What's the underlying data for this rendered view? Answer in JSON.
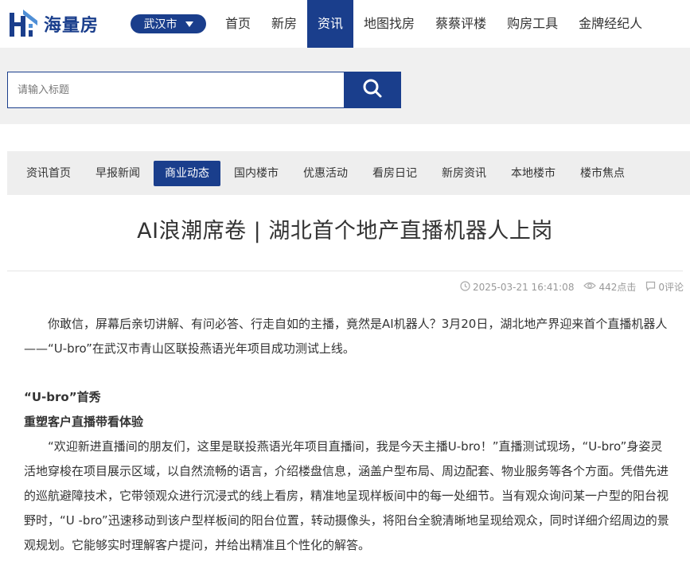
{
  "header": {
    "logo_text": "海量房",
    "city": "武汉市",
    "nav": [
      {
        "label": "首页",
        "active": false
      },
      {
        "label": "新房",
        "active": false
      },
      {
        "label": "资讯",
        "active": true
      },
      {
        "label": "地图找房",
        "active": false
      },
      {
        "label": "蔡蔡评楼",
        "active": false
      },
      {
        "label": "购房工具",
        "active": false
      },
      {
        "label": "金牌经纪人",
        "active": false
      }
    ]
  },
  "search": {
    "placeholder": "请输入标题",
    "value": ""
  },
  "subnav": [
    {
      "label": "资讯首页",
      "active": false
    },
    {
      "label": "早报新闻",
      "active": false
    },
    {
      "label": "商业动态",
      "active": true
    },
    {
      "label": "国内楼市",
      "active": false
    },
    {
      "label": "优惠活动",
      "active": false
    },
    {
      "label": "看房日记",
      "active": false
    },
    {
      "label": "新房资讯",
      "active": false
    },
    {
      "label": "本地楼市",
      "active": false
    },
    {
      "label": "楼市焦点",
      "active": false
    }
  ],
  "article": {
    "title": "AI浪潮席卷 | 湖北首个地产直播机器人上岗",
    "date": "2025-03-21 16:41:08",
    "views": "442点击",
    "comments": "0评论",
    "para1": "你敢信，屏幕后亲切讲解、有问必答、行走自如的主播，竟然是AI机器人？3月20日，湖北地产界迎来首个直播机器人——“U-bro”在武汉市青山区联投燕语光年项目成功测试上线。",
    "heading1": "“U-bro”首秀",
    "heading2": "重塑客户直播带看体验",
    "para2": "“欢迎新进直播间的朋友们，这里是联投燕语光年项目直播间，我是今天主播U-bro！”直播测试现场，“U-bro”身姿灵活地穿梭在项目展示区域，以自然流畅的语言，介绍楼盘信息，涵盖户型布局、周边配套、物业服务等各个方面。凭借先进的巡航避障技术，它带领观众进行沉浸式的线上看房，精准地呈现样板间中的每一处细节。当有观众询问某一户型的阳台视野时，“U -bro”迅速移动到该户型样板间的阳台位置，转动摄像头，将阳台全貌清晰地呈现给观众，同时详细介绍周边的景观规划。它能够实时理解客户提问，并给出精准且个性化的解答。"
  },
  "colors": {
    "brand": "#1a3e8c",
    "band_bg": "#f0f0f0",
    "subnav_bg": "#eeeeee",
    "meta_text": "#999999"
  },
  "icons": {
    "logo": "house-logo-icon",
    "search": "search-icon",
    "caret": "caret-down-icon",
    "date": "clock-icon",
    "views": "eye-icon",
    "comments": "comment-icon"
  }
}
